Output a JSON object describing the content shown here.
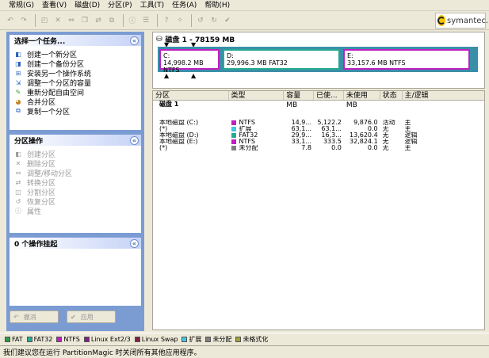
{
  "menu": [
    "常规(G)",
    "查看(V)",
    "磁盘(D)",
    "分区(P)",
    "工具(T)",
    "任务(A)",
    "帮助(H)"
  ],
  "logo": {
    "text": "symantec."
  },
  "tasks_panel": {
    "title": "选择一个任务...",
    "items": [
      {
        "label": "创建一个新分区",
        "icon": "new-partition-icon"
      },
      {
        "label": "创建一个备份分区",
        "icon": "backup-partition-icon"
      },
      {
        "label": "安装另一个操作系统",
        "icon": "install-os-icon"
      },
      {
        "label": "调整一个分区的容量",
        "icon": "resize-icon"
      },
      {
        "label": "重新分配自由空间",
        "icon": "redistribute-icon"
      },
      {
        "label": "合并分区",
        "icon": "merge-icon"
      },
      {
        "label": "复制一个分区",
        "icon": "copy-icon"
      }
    ]
  },
  "ops_panel": {
    "title": "分区操作",
    "items": [
      {
        "label": "创建分区"
      },
      {
        "label": "删除分区"
      },
      {
        "label": "调整/移动分区"
      },
      {
        "label": "转换分区"
      },
      {
        "label": "分割分区"
      },
      {
        "label": "恢复分区"
      },
      {
        "label": "属性"
      }
    ]
  },
  "pending_panel": {
    "title": "0 个操作挂起"
  },
  "buttons": {
    "undo": "撤消",
    "apply": "应用"
  },
  "disk": {
    "title": "磁盘 1 - 78159 MB",
    "partitions": [
      {
        "letter": "C:",
        "size": "14,998.2 MB",
        "fs": "NTFS",
        "color": "#c020c0"
      },
      {
        "letter": "D:",
        "size": "29,996.3 MB",
        "fs": "FAT32",
        "color": "#28a890"
      },
      {
        "letter": "E:",
        "size": "33,157.6 MB",
        "fs": "NTFS",
        "color": "#c020c0"
      }
    ]
  },
  "table": {
    "columns": [
      "分区",
      "类型",
      "容量 MB",
      "已使...",
      "未使用 MB",
      "状态",
      "主/逻辑"
    ],
    "group": "磁盘 1",
    "rows": [
      {
        "name": "本地磁盘 (C:)",
        "type": "NTFS",
        "color": "#c020c0",
        "capacity": "14,9...",
        "used": "5,122.2",
        "unused": "9,876.0",
        "status": "活动",
        "kind": "主"
      },
      {
        "name": "(*)",
        "type": "扩展",
        "color": "#40c8e0",
        "capacity": "63,1...",
        "used": "63,1...",
        "unused": "0.0",
        "status": "无",
        "kind": "主"
      },
      {
        "name": "本地磁盘 (D:)",
        "type": "FAT32",
        "color": "#28a890",
        "capacity": "29,9...",
        "used": "16,3...",
        "unused": "13,620.4",
        "status": "无",
        "kind": "逻辑"
      },
      {
        "name": "本地磁盘 (E:)",
        "type": "NTFS",
        "color": "#c020c0",
        "capacity": "33,1...",
        "used": "333.5",
        "unused": "32,824.1",
        "status": "无",
        "kind": "逻辑"
      },
      {
        "name": "(*)",
        "type": "未分配",
        "color": "#808080",
        "capacity": "7.8",
        "used": "0.0",
        "unused": "0.0",
        "status": "无",
        "kind": "主"
      }
    ]
  },
  "legend": [
    {
      "label": "FAT",
      "color": "#2c9a48"
    },
    {
      "label": "FAT32",
      "color": "#28a890"
    },
    {
      "label": "NTFS",
      "color": "#c020c0"
    },
    {
      "label": "Linux Ext2/3",
      "color": "#802080"
    },
    {
      "label": "Linux Swap",
      "color": "#802040"
    },
    {
      "label": "扩展",
      "color": "#40c8e0"
    },
    {
      "label": "未分配",
      "color": "#808080"
    },
    {
      "label": "未格式化",
      "color": "#a0a040"
    }
  ],
  "status_bar": "我们建议您在运行 PartitionMagic 时关闭所有其他应用程序。"
}
